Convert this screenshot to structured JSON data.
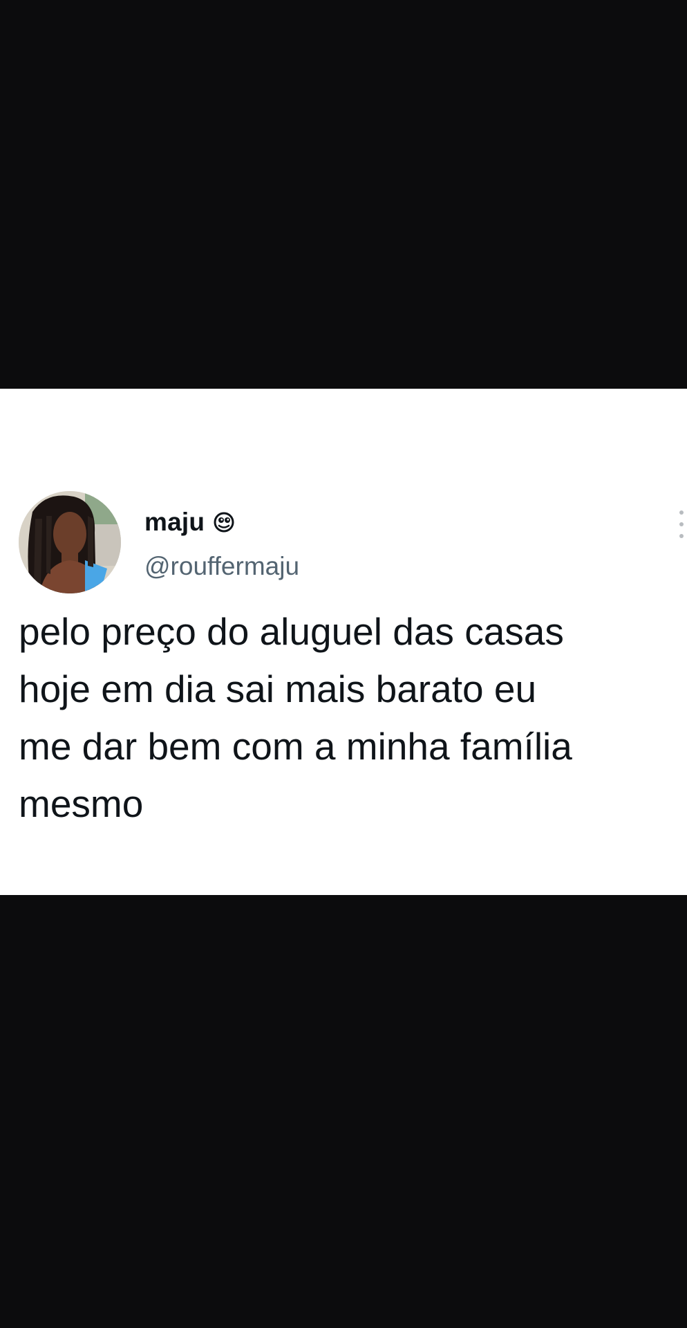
{
  "tweet": {
    "display_name": "maju",
    "handle": "@rouffermaju",
    "text": "pelo preço do aluguel das casas\nhoje em dia sai mais barato eu\nme dar bem com a minha família\nmesmo",
    "name_emoji_icon": "peeking-eye-emoji-icon",
    "more_icon": "more-options-icon"
  },
  "colors": {
    "background": "#0c0c0d",
    "card": "#ffffff",
    "name": "#0f1419",
    "handle": "#536471"
  }
}
